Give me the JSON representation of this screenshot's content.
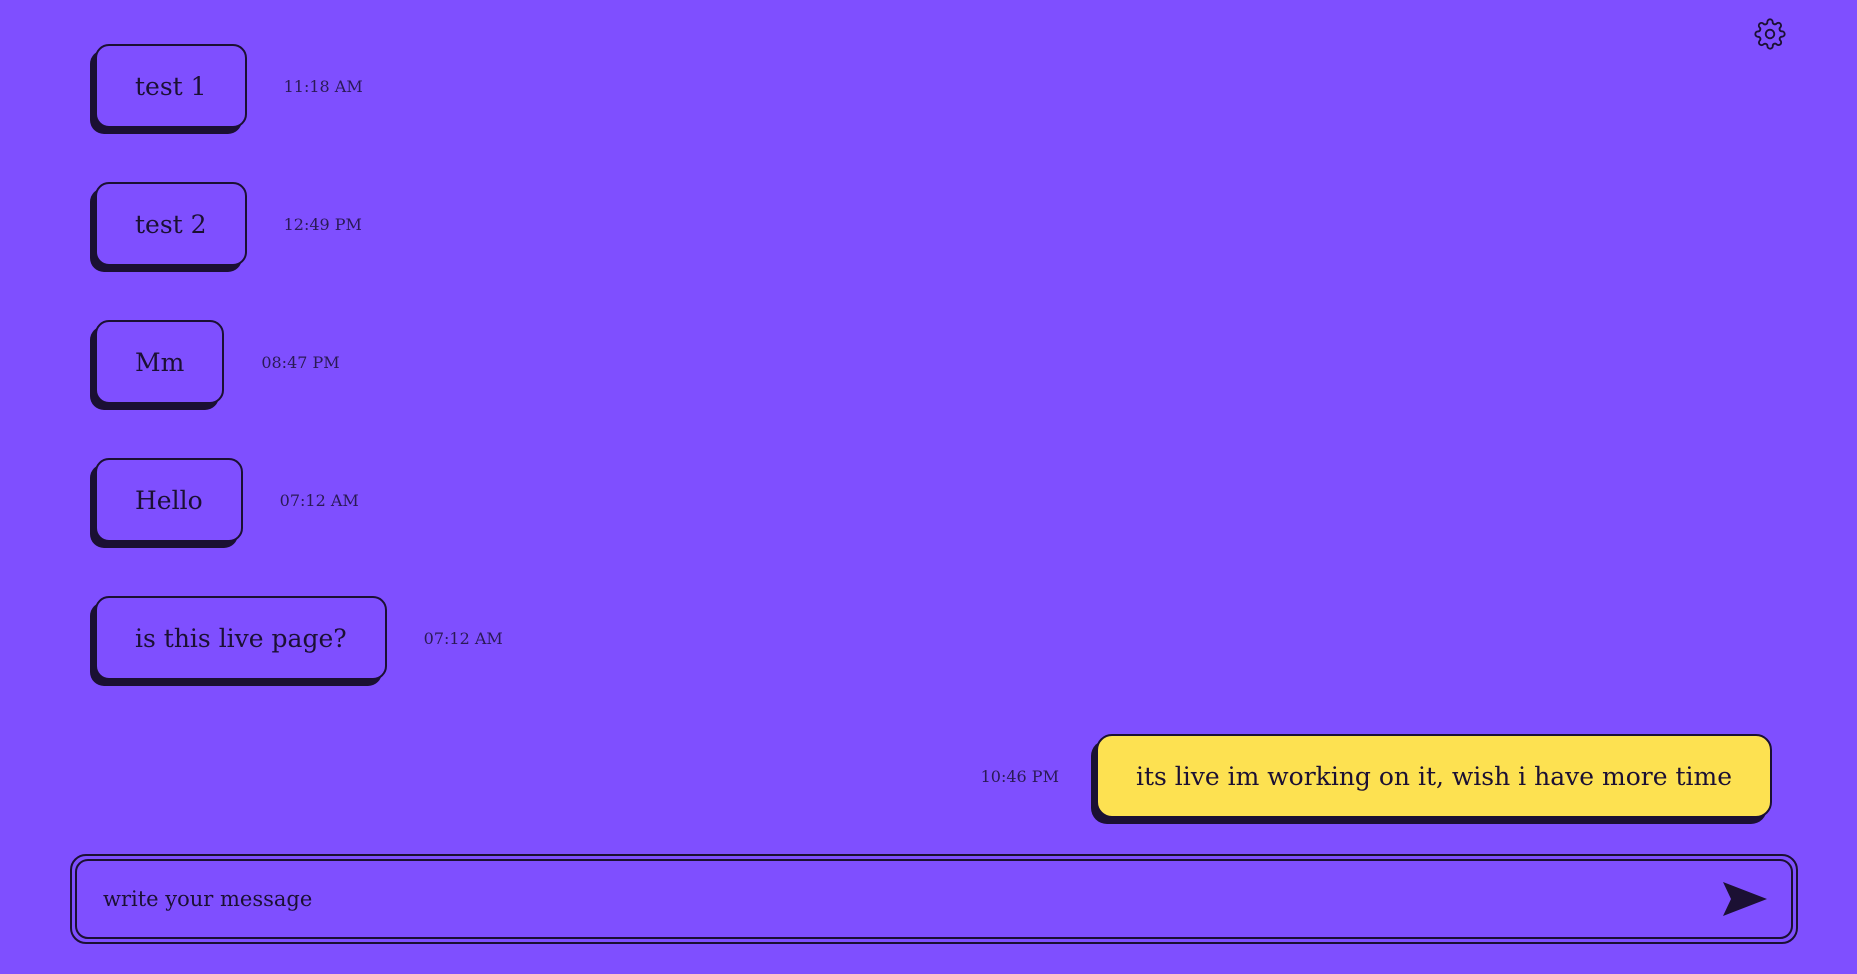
{
  "header": {
    "settings_icon": "gear-icon"
  },
  "messages": [
    {
      "text": "test 1",
      "time": "11:18 AM",
      "direction": "incoming"
    },
    {
      "text": "test 2",
      "time": "12:49 PM",
      "direction": "incoming"
    },
    {
      "text": "Mm",
      "time": "08:47 PM",
      "direction": "incoming"
    },
    {
      "text": "Hello",
      "time": "07:12 AM",
      "direction": "incoming"
    },
    {
      "text": "is this live page?",
      "time": "07:12 AM",
      "direction": "incoming"
    },
    {
      "text": "its live im working on it, wish i have more time",
      "time": "10:46 PM",
      "direction": "outgoing"
    }
  ],
  "composer": {
    "value": "",
    "placeholder": "write your message",
    "send_icon": "send-icon"
  },
  "colors": {
    "background": "#7f4fff",
    "outgoing_bubble": "#fde151",
    "ink": "#1b1033"
  }
}
